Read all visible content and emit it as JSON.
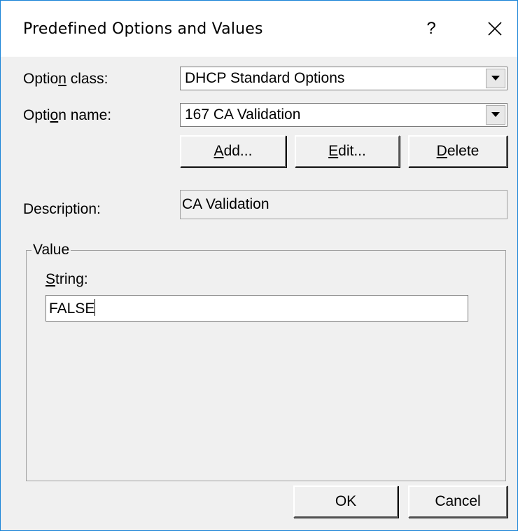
{
  "dialog": {
    "title": "Predefined Options and Values",
    "help_label": "?"
  },
  "option_class": {
    "label_pre": "Optio",
    "label_key": "n",
    "label_post": " class:",
    "value": "DHCP Standard Options"
  },
  "option_name": {
    "label_pre": "Opti",
    "label_key": "o",
    "label_post": "n name:",
    "value": "167 CA Validation"
  },
  "buttons": {
    "add": {
      "key": "A",
      "rest": "dd..."
    },
    "edit": {
      "key": "E",
      "rest": "dit..."
    },
    "delete": {
      "key": "D",
      "rest": "elete"
    },
    "ok": "OK",
    "cancel": "Cancel"
  },
  "description": {
    "label": "Description:",
    "value": "CA Validation"
  },
  "value_group": {
    "legend": "Value",
    "string_key": "S",
    "string_rest": "tring:",
    "string_value": "FALSE"
  },
  "icons": [
    "help-icon",
    "close-icon",
    "dropdown-arrow-icon"
  ]
}
